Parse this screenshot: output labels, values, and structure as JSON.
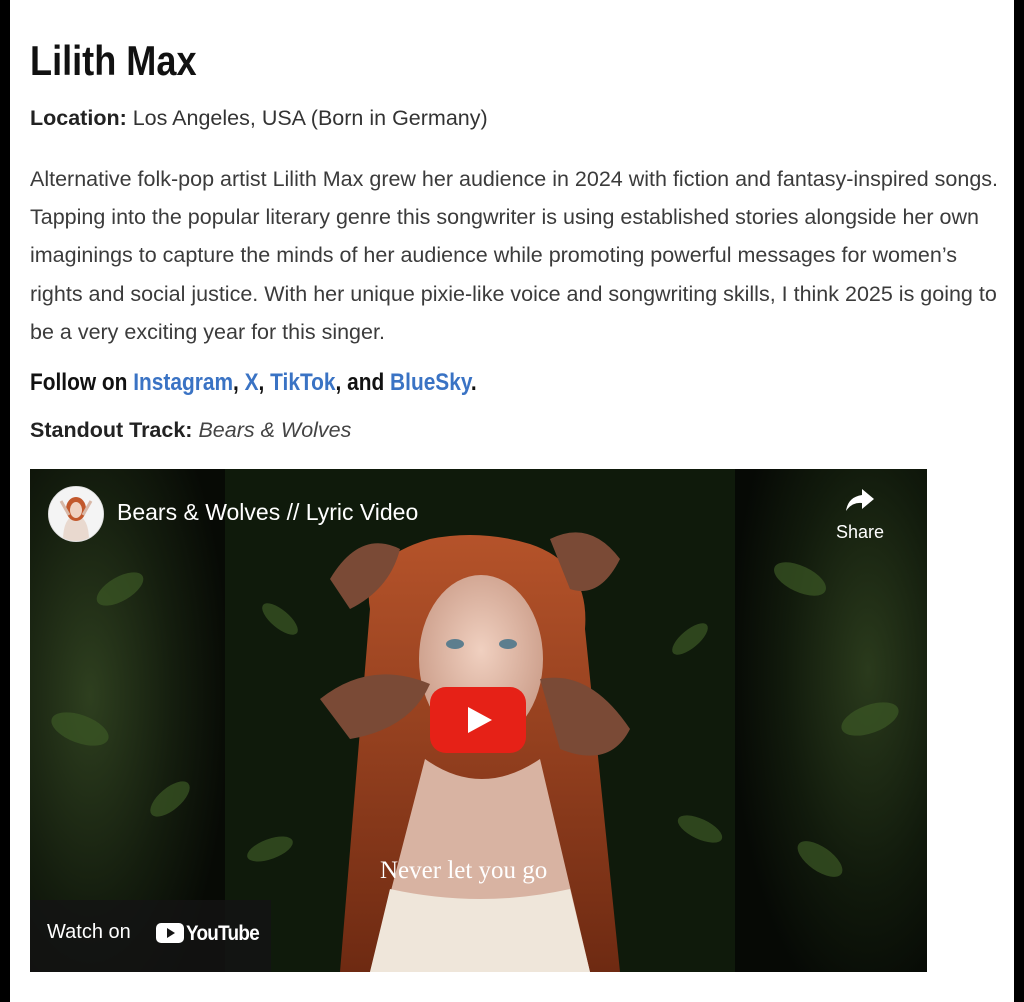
{
  "artist": {
    "name": "Lilith Max",
    "location_label": "Location:",
    "location_value": " Los Angeles, USA (Born in Germany)",
    "bio": "Alternative folk-pop artist Lilith Max grew her audience in 2024 with fiction and fantasy-inspired songs. Tapping into the popular literary genre this songwriter is using established stories alongside her own imaginings to capture the minds of her audience while promoting powerful messages for women’s rights and social justice. With her unique pixie-like voice and songwriting skills, I think 2025 is going to be a very exciting year for this singer."
  },
  "follow": {
    "prefix": "Follow on ",
    "links": [
      "Instagram",
      "X",
      "TikTok",
      "BlueSky"
    ],
    "sep1": ", ",
    "sep2": ", ",
    "sep3": ", and ",
    "suffix": "."
  },
  "standout": {
    "label": "Standout Track:",
    "track": "Bears & Wolves"
  },
  "video": {
    "title": "Bears & Wolves // Lyric Video",
    "share_label": "Share",
    "lyric_text": "Never let you go",
    "watch_on_label": "Watch on",
    "youtube_wordmark": "YouTube",
    "play_color": "#e62117"
  },
  "colors": {
    "link": "#3a73c4",
    "page_bg": "#ffffff",
    "frame_bg": "#000000"
  }
}
